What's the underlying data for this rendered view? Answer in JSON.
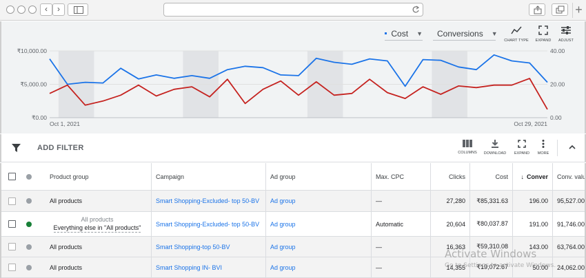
{
  "browser": {
    "back": "‹",
    "forward": "›",
    "new_tab": "+"
  },
  "chart_toolbar": {
    "series1_label": "Cost",
    "series2_label": "Conversions",
    "chart_type_label": "CHART TYPE",
    "expand_label": "EXPAND",
    "adjust_label": "ADJUST",
    "colors": {
      "cost": "#1a73e8",
      "conversions": "#c5221f"
    }
  },
  "chart_data": {
    "type": "line",
    "x_start_label": "Oct 1, 2021",
    "x_end_label": "Oct 29, 2021",
    "y_left_ticks": [
      "₹0.00",
      "₹5,000.00",
      "₹10,000.00"
    ],
    "y_right_ticks": [
      "0.00",
      "20.00",
      "40.00"
    ],
    "ylim_left": [
      0,
      10000
    ],
    "ylim_right": [
      0,
      40
    ],
    "weekend_bands": true,
    "grid": true,
    "series": [
      {
        "name": "Cost",
        "axis": "left",
        "values": [
          8800,
          5000,
          5300,
          5200,
          7400,
          5800,
          6400,
          5900,
          6300,
          5900,
          7200,
          7700,
          7500,
          6400,
          6300,
          8900,
          8300,
          8000,
          8800,
          8500,
          4700,
          8700,
          8600,
          7600,
          7200,
          9400,
          8500,
          8200,
          5300
        ]
      },
      {
        "name": "Conversions",
        "axis": "right",
        "values": [
          14.5,
          19.5,
          7.5,
          10,
          13.5,
          19.5,
          13,
          17,
          18.5,
          12.5,
          23,
          8.5,
          17,
          22,
          13.5,
          21.5,
          13.5,
          14.5,
          23,
          15,
          11.5,
          18.5,
          14,
          19,
          18,
          19.5,
          19.5,
          23.5,
          5
        ]
      }
    ]
  },
  "filter_bar": {
    "add_filter_label": "ADD FILTER",
    "columns_label": "COLUMNS",
    "download_label": "DOWNLOAD",
    "expand_label": "EXPAND",
    "more_label": "MORE"
  },
  "table": {
    "headers": {
      "product_group": "Product group",
      "campaign": "Campaign",
      "ad_group": "Ad group",
      "max_cpc": "Max. CPC",
      "clicks": "Clicks",
      "cost": "Cost",
      "conversions": "Conver",
      "conv_value": "Conv. value"
    },
    "rows": [
      {
        "product_group": "All products",
        "product_group_sub": "",
        "campaign": "Smart Shopping-Excluded- top 50-BV",
        "ad_group": "Ad group",
        "max_cpc": "—",
        "clicks": "27,280",
        "cost": "₹85,331.63",
        "conversions": "196.00",
        "conv_value": "95,527.00",
        "status": "gray"
      },
      {
        "product_group": "Everything else in \"All products\"",
        "product_group_sub": "All products",
        "campaign": "Smart Shopping-Excluded- top 50-BV",
        "ad_group": "Ad group",
        "max_cpc": "Automatic",
        "clicks": "20,604",
        "cost": "₹80,037.87",
        "conversions": "191.00",
        "conv_value": "91,746.00",
        "status": "green"
      },
      {
        "product_group": "All products",
        "product_group_sub": "",
        "campaign": "Smart Shopping-top 50-BV",
        "ad_group": "Ad group",
        "max_cpc": "—",
        "clicks": "16,363",
        "cost": "₹59,310.08",
        "conversions": "143.00",
        "conv_value": "63,764.00",
        "status": "gray"
      },
      {
        "product_group": "All products",
        "product_group_sub": "",
        "campaign": "Smart Shopping IN- BVI",
        "ad_group": "Ad group",
        "max_cpc": "—",
        "clicks": "14,355",
        "cost": "₹19,072.67",
        "conversions": "50.00",
        "conv_value": "24,062.00",
        "status": "gray"
      }
    ]
  },
  "watermark": {
    "title": "Activate Windows",
    "subtitle": "Go to Settings to activate Windows."
  }
}
